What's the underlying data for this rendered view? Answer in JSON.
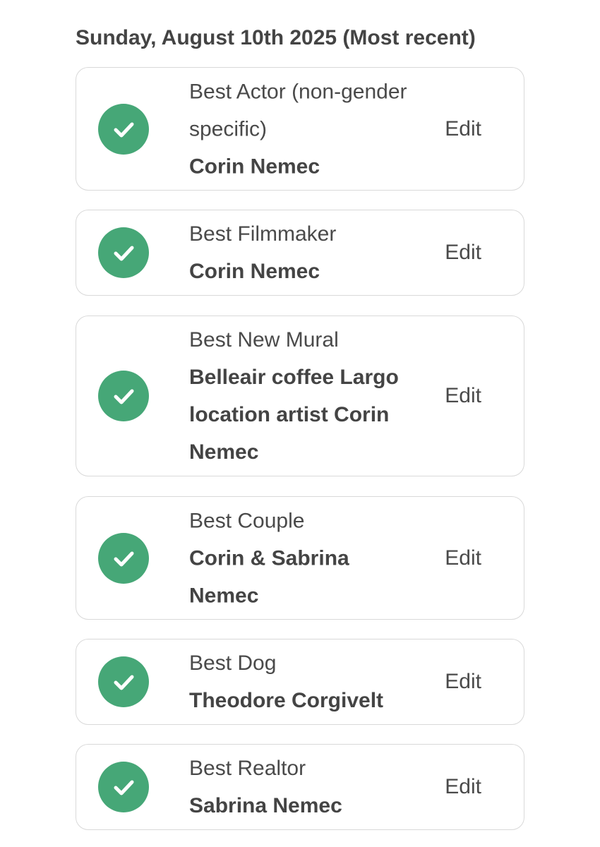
{
  "heading": "Sunday, August 10th 2025 (Most recent)",
  "accent_color": "#46a777",
  "entries": [
    {
      "category": "Best Actor (non-gender specific)",
      "winner": "Corin Nemec",
      "edit_label": "Edit",
      "status_icon": "checkmark-circle-icon"
    },
    {
      "category": "Best Filmmaker",
      "winner": "Corin Nemec",
      "edit_label": "Edit",
      "status_icon": "checkmark-circle-icon"
    },
    {
      "category": "Best New Mural",
      "winner": "Belleair coffee Largo location artist Corin Nemec",
      "edit_label": "Edit",
      "status_icon": "checkmark-circle-icon"
    },
    {
      "category": "Best Couple",
      "winner": "Corin & Sabrina Nemec",
      "edit_label": "Edit",
      "status_icon": "checkmark-circle-icon"
    },
    {
      "category": "Best Dog",
      "winner": "Theodore Corgivelt",
      "edit_label": "Edit",
      "status_icon": "checkmark-circle-icon"
    },
    {
      "category": "Best Realtor",
      "winner": "Sabrina Nemec",
      "edit_label": "Edit",
      "status_icon": "checkmark-circle-icon"
    }
  ]
}
